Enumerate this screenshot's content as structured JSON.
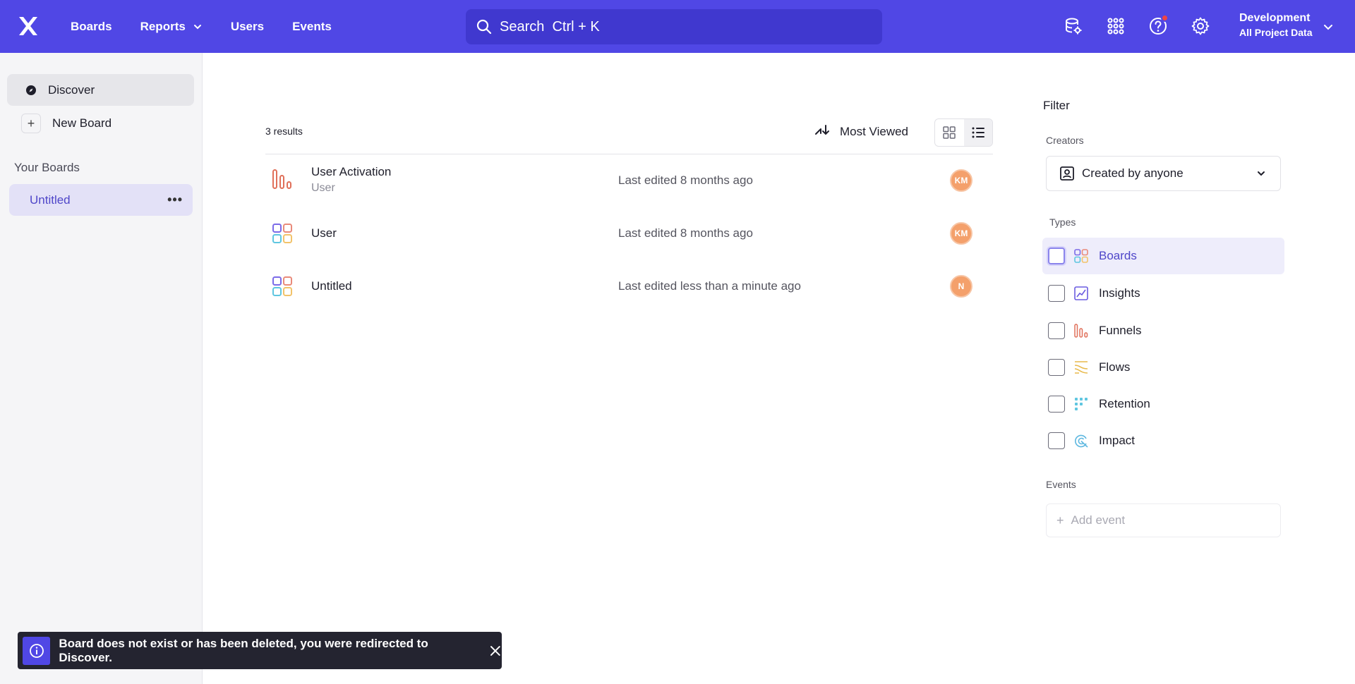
{
  "colors": {
    "brand": "#5047e5",
    "accent_text": "#4f46c9",
    "avatar": "#f4a06b",
    "notification": "#ef4444"
  },
  "header": {
    "logo_icon": "x-logo-icon",
    "nav": [
      {
        "label": "Boards"
      },
      {
        "label": "Reports",
        "has_dropdown": true
      },
      {
        "label": "Users"
      },
      {
        "label": "Events"
      }
    ],
    "search": {
      "placeholder": "Search  Ctrl + K",
      "value": ""
    },
    "icons": [
      "database-settings-icon",
      "apps-grid-icon",
      "help-icon",
      "gear-icon"
    ],
    "project": {
      "name": "Development",
      "subtitle": "All Project Data"
    }
  },
  "sidebar": {
    "discover_label": "Discover",
    "new_board_label": "New Board",
    "your_boards_heading": "Your Boards",
    "boards": [
      {
        "label": "Untitled",
        "selected": true
      }
    ]
  },
  "main": {
    "results_count": "3 results",
    "sort_label": "Most Viewed",
    "view_mode": "list",
    "items": [
      {
        "icon": "funnel-icon",
        "title": "User Activation",
        "subtitle": "User",
        "edited": "Last edited 8 months ago",
        "avatar": "KM"
      },
      {
        "icon": "board-icon",
        "title": "User",
        "subtitle": "",
        "edited": "Last edited 8 months ago",
        "avatar": "KM"
      },
      {
        "icon": "board-icon",
        "title": "Untitled",
        "subtitle": "",
        "edited": "Last edited less than a minute ago",
        "avatar": "N"
      }
    ]
  },
  "filter": {
    "title": "Filter",
    "creators_label": "Creators",
    "creators_value": "Created by anyone",
    "types_label": "Types",
    "types": [
      {
        "label": "Boards",
        "icon": "board-icon",
        "checked": false
      },
      {
        "label": "Insights",
        "icon": "insights-icon",
        "checked": false
      },
      {
        "label": "Funnels",
        "icon": "funnel-icon",
        "checked": false
      },
      {
        "label": "Flows",
        "icon": "flows-icon",
        "checked": false
      },
      {
        "label": "Retention",
        "icon": "retention-icon",
        "checked": false
      },
      {
        "label": "Impact",
        "icon": "impact-icon",
        "checked": false
      }
    ],
    "events_label": "Events",
    "add_event_placeholder": "Add event"
  },
  "toast": {
    "message": "Board does not exist or has been deleted, you were redirected to Discover."
  }
}
